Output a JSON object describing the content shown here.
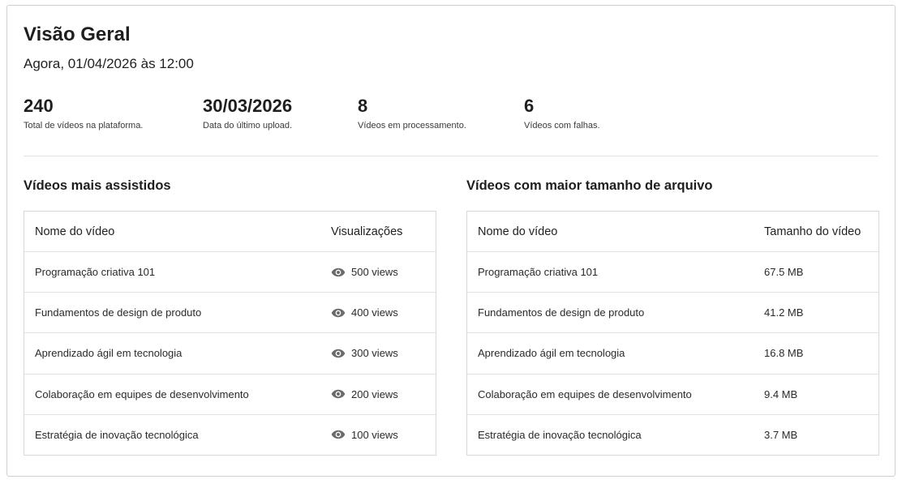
{
  "header": {
    "title": "Visão Geral",
    "subtitle": "Agora, 01/04/2026 às 12:00"
  },
  "stats": [
    {
      "value": "240",
      "label": "Total de vídeos na plataforma."
    },
    {
      "value": "30/03/2026",
      "label": "Data do último upload."
    },
    {
      "value": "8",
      "label": "Vídeos em processamento."
    },
    {
      "value": "6",
      "label": "Vídeos com falhas."
    }
  ],
  "most_watched": {
    "title": "Vídeos mais assistidos",
    "col_name": "Nome do vídeo",
    "col_views": "Visualizações",
    "icon": "eye-icon",
    "rows": [
      {
        "name": "Programação criativa 101",
        "views": "500 views"
      },
      {
        "name": "Fundamentos de design de produto",
        "views": "400 views"
      },
      {
        "name": "Aprendizado ágil em tecnologia",
        "views": "300 views"
      },
      {
        "name": "Colaboração em equipes de desenvolvimento",
        "views": "200 views"
      },
      {
        "name": "Estratégia de inovação tecnológica",
        "views": "100 views"
      }
    ]
  },
  "largest_files": {
    "title": "Vídeos com maior tamanho de arquivo",
    "col_name": "Nome do vídeo",
    "col_size": "Tamanho do vídeo",
    "rows": [
      {
        "name": "Programação criativa 101",
        "size": "67.5 MB"
      },
      {
        "name": "Fundamentos de design de produto",
        "size": "41.2 MB"
      },
      {
        "name": "Aprendizado ágil em tecnologia",
        "size": "16.8 MB"
      },
      {
        "name": "Colaboração em equipes de desenvolvimento",
        "size": "9.4 MB"
      },
      {
        "name": "Estratégia de inovação tecnológica",
        "size": "3.7 MB"
      }
    ]
  },
  "colors": {
    "border": "#cfcfcf",
    "text": "#1e1e1e",
    "icon": "#6b6b6b"
  }
}
